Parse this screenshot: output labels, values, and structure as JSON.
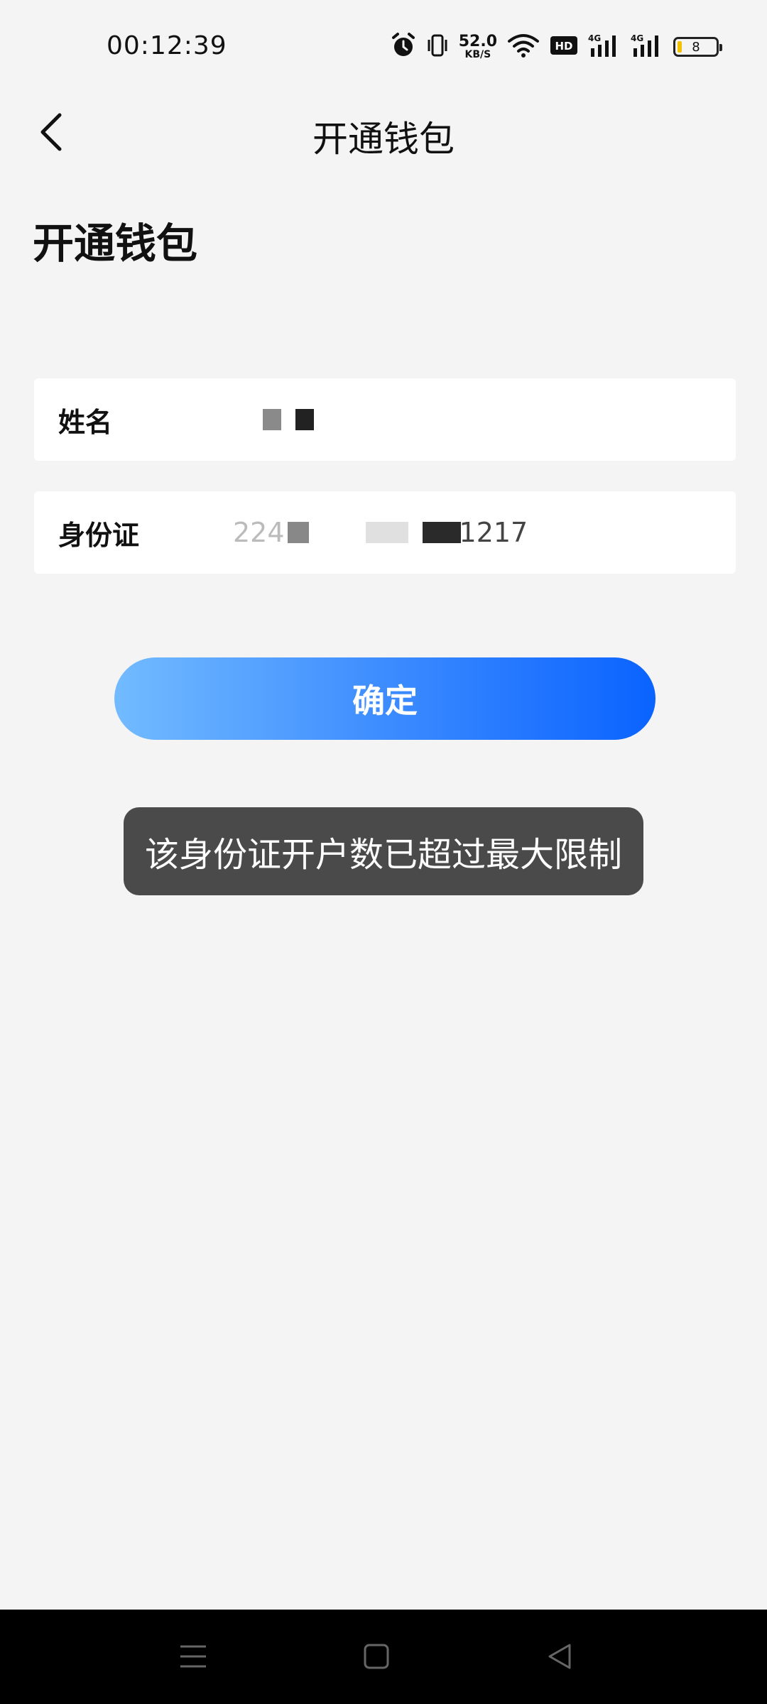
{
  "status_bar": {
    "time": "00:12:39",
    "net_speed_value": "52.0",
    "net_speed_unit": "KB/S",
    "battery_level": "8",
    "icons": [
      "alarm-icon",
      "vibrate-icon",
      "wifi-icon",
      "hd-icon",
      "signal-4g-icon",
      "signal-4g-icon",
      "battery-icon"
    ]
  },
  "nav": {
    "title": "开通钱包",
    "back_icon": "chevron-left-icon"
  },
  "form": {
    "heading": "开通钱包",
    "name_label": "姓名",
    "id_label": "身份证",
    "id_value_visible_prefix": "224",
    "id_value_visible_suffix": "1217"
  },
  "confirm_button": {
    "label": "确定"
  },
  "toast": {
    "message": "该身份证开户数已超过最大限制"
  },
  "system_nav": {
    "icons": [
      "menu-icon",
      "home-icon",
      "back-triangle-icon"
    ]
  },
  "colors": {
    "background": "#f4f4f5",
    "button_gradient_start": "#72bbff",
    "button_gradient_end": "#0a63ff",
    "toast_bg": "#4a4a4a"
  }
}
